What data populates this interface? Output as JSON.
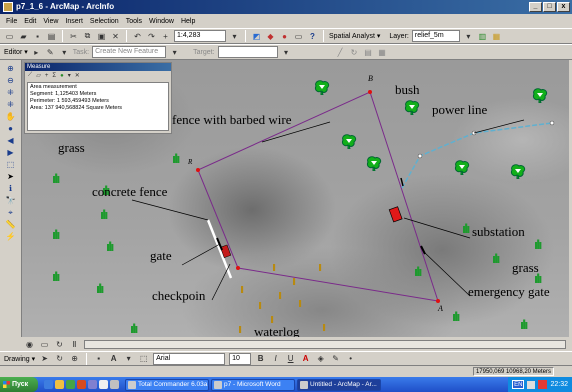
{
  "window": {
    "title": "p7_1_6 - ArcMap - ArcInfo",
    "min": "_",
    "max": "□",
    "close": "x"
  },
  "menu": [
    "File",
    "Edit",
    "View",
    "Insert",
    "Selection",
    "Tools",
    "Window",
    "Help"
  ],
  "toolbar": {
    "scale": "1:4,283",
    "spatial_analyst": "Spatial Analyst ▾",
    "layer_label": "Layer:",
    "layer_value": "relief_5m"
  },
  "editor": {
    "editor_label": "Editor ▾",
    "task_label": "Task:",
    "task_value": "Create New Feature",
    "target_label": "Target:"
  },
  "measure": {
    "title": "Measure",
    "lines": [
      "Area measurement",
      "Segment: 1,125403 Meters",
      "Perimeter: 1 593,459493 Meters",
      "Area: 137 940,568824 Square Meters"
    ]
  },
  "map_labels": {
    "fence": "fence with barbed wire",
    "bush": "bush",
    "power_line": "power line",
    "grass_left": "grass",
    "concrete_fence": "concrete fence",
    "gate": "gate",
    "checkpoint": "checkpoin",
    "substation": "substation",
    "grass_right": "grass",
    "emergency_gate": "emergency gate",
    "waterlog": "waterlog",
    "vertex_b": "B",
    "vertex_a": "A",
    "vertex_r": "R"
  },
  "drawing": {
    "label": "Drawing ▾",
    "font": "Arial",
    "size": "10",
    "bold": "B",
    "italic": "I",
    "underline": "U"
  },
  "status": {
    "coords": "17950,069  10968,20 Meters"
  },
  "taskbar": {
    "start": "Пуск",
    "tasks": [
      "Total Commander 6.03a ...",
      "p7 - Microsoft Word",
      "Untitled - ArcMap - Ar..."
    ],
    "lang": "EN",
    "clock": "22:32"
  }
}
